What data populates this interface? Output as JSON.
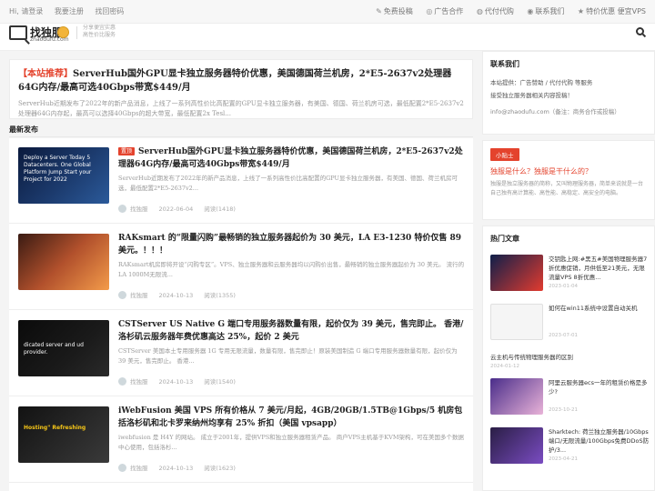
{
  "topbar": {
    "greeting": "Hi, 请登录",
    "register": "我要注册",
    "find_password": "找回密码",
    "links": [
      "免费投稿",
      "广告合作",
      "代付代购",
      "联系我们",
      "特价优惠 便宜VPS"
    ]
  },
  "header": {
    "logo_text": "找独服",
    "logo_sub": "zhaodufu.com",
    "slogan_line1": "分享便宜实惠",
    "slogan_line2": "高性价比服务"
  },
  "featured": {
    "tag": "【本站推荐】",
    "title": "ServerHub国外GPU显卡独立服务器特价优惠，美国德国荷兰机房，2*E5-2637v2处理器64G内存/最高可选40Gbps带宽$449/月",
    "desc": "ServerHub近期发布了2022年的新产品消息，上线了一系列高性价比高配置的GPU显卡独立服务器，有美国、德国、荷兰机房可选，最低配置2*E5-2637v2处理器64G内存起，最高可以选择40Gbps的超大带宽，最低配置2x Tesl..."
  },
  "section": {
    "title": "最新发布"
  },
  "posts": [
    {
      "tag": "置顶",
      "title": "ServerHub国外GPU显卡独立服务器特价优惠，美国德国荷兰机房，2*E5-2637v2处理器64G内存/最高可选40Gbps带宽$449/月",
      "desc": "ServerHub近期发布了2022年的新产品消息，上线了一系列高性价比高配置的GPU显卡独立服务器，有美国、德国、荷兰机房可选，最低配置2*E5-2637v2...",
      "author": "找独服",
      "date": "2022-06-04",
      "views": "阅读(1418)",
      "thumb_text": "Deploy a Server Today 5 Datacenters. One Global Platform Jump Start your Project for 2022"
    },
    {
      "tag": "",
      "title": "RAKsmart 的“限量闪购”最畅销的独立服务器起价为 30 美元，LA E3-1230 特价仅售 89 美元。！！！",
      "desc": "RAKsmart机房即将开设“闪购专区”。VPS、独立服务器和云服务器均以闪购价出售，最畅销的独立服务器起价为 30 美元。 流行的 LA 1000M无限流...",
      "author": "找独服",
      "date": "2024-10-13",
      "views": "阅读(1355)",
      "thumb_text": ""
    },
    {
      "tag": "",
      "title": "CSTServer US Native G 端口专用服务器数量有限，起价仅为 39 美元，售完即止。 香港/洛杉矶云服务器年费优惠高达 25%，起价 2 美元",
      "desc": "CSTServer 美国本土专用服务器 1G 专用无限流量，数量有限，售完即止！原装美国制造 G 端口专用服务器数量有限，起价仅为 39 美元，售完即止。 香港...",
      "author": "找独服",
      "date": "2024-10-13",
      "views": "阅读(1540)",
      "thumb_text": "dicated server and ud provider."
    },
    {
      "tag": "",
      "title": "iWebFusion 美国 VPS 所有价格从 7 美元/月起，4GB/20GB/1.5TB@1Gbps/5 机房包括洛杉矶和北卡罗来纳州均享有 25% 折扣（美国 vpsapp）",
      "desc": "iwebfusion 是 H4Y 的网站。 成立于2001年，提供VPS和独立服务器租赁产品。 商户VPS主机基于KVM架构，可在美国多个数据中心使用，包括洛杉...",
      "author": "找独服",
      "date": "2024-10-13",
      "views": "阅读(1623)",
      "thumb_text": "Hosting\" Refreshing"
    }
  ],
  "sidebar": {
    "contact": {
      "title": "联系我们",
      "line1": "本站提供：广告赞助 / 代付代购 等服务",
      "line2": "接受独立服务器相关内容投稿！",
      "line3": "info@zhaodufu.com（备注：商务合作或投稿）"
    },
    "tip": {
      "button": "小贴士",
      "title": "独服是什么？独服是干什么的？",
      "desc": "独服是独立服务器的简称，又叫物理服务器，简单来说就是一台自己独有高计算能、高性能、高稳定、高安全的电脑。"
    },
    "hot": {
      "title": "热门文章",
      "items": [
        {
          "title": "交钥匙上网:#黑五#美国物理服务器7折优惠促销，月供低至21美元，无限流量VPS 8折优惠...",
          "date": "2023-01-04",
          "has_thumb": true
        },
        {
          "title": "如何在win11系统中设置自动关机",
          "date": "2023-07-01",
          "has_thumb": true
        },
        {
          "title": "云主机与传统物理服务器的区别",
          "date": "2024-01-12",
          "has_thumb": false
        },
        {
          "title": "阿里云服务器ecs一年的租赁价格是多少?",
          "date": "2023-10-21",
          "has_thumb": true
        },
        {
          "title": "Sharktech: 荷兰独立服务器/10Gbps端口/无限流量/100Gbps免费DDoS防护/3...",
          "date": "2023-04-21",
          "has_thumb": true
        }
      ]
    }
  }
}
